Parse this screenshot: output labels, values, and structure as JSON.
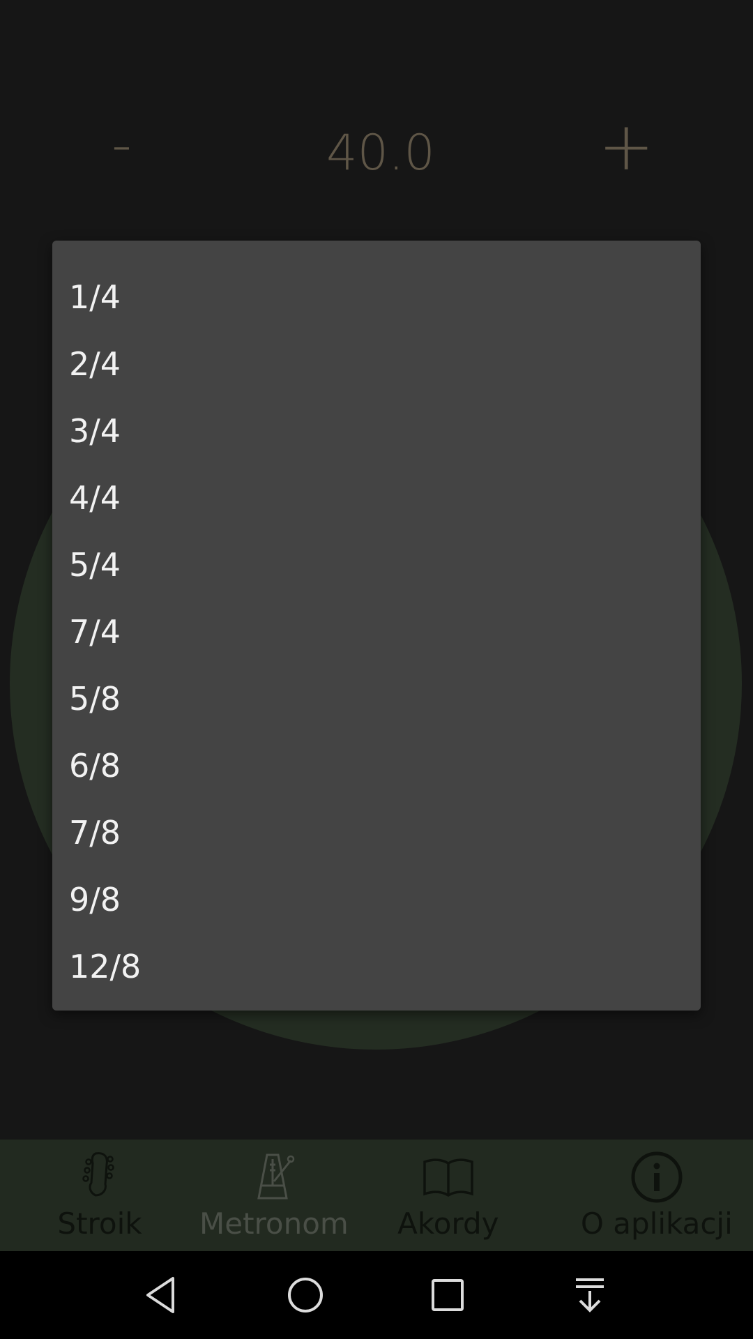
{
  "tempo": {
    "minus_label": "-",
    "value": "40.0",
    "plus_label": "+"
  },
  "time_signature_menu": {
    "options": [
      "1/4",
      "2/4",
      "3/4",
      "4/4",
      "5/4",
      "7/4",
      "5/8",
      "6/8",
      "7/8",
      "9/8",
      "12/8"
    ]
  },
  "bottom_nav": {
    "items": [
      {
        "label": "Stroik",
        "icon": "guitar-headstock-icon"
      },
      {
        "label": "Metronom",
        "icon": "metronome-icon"
      },
      {
        "label": "Akordy",
        "icon": "open-book-icon"
      },
      {
        "label": "O aplikacji",
        "icon": "info-icon"
      }
    ],
    "active": "Metronom"
  },
  "system_nav": {
    "buttons": [
      "back-icon",
      "home-icon",
      "recents-icon",
      "notifications-pull-icon"
    ]
  },
  "colors": {
    "background": "#161616",
    "popup": "#444444",
    "accent_green": "#242d22"
  }
}
